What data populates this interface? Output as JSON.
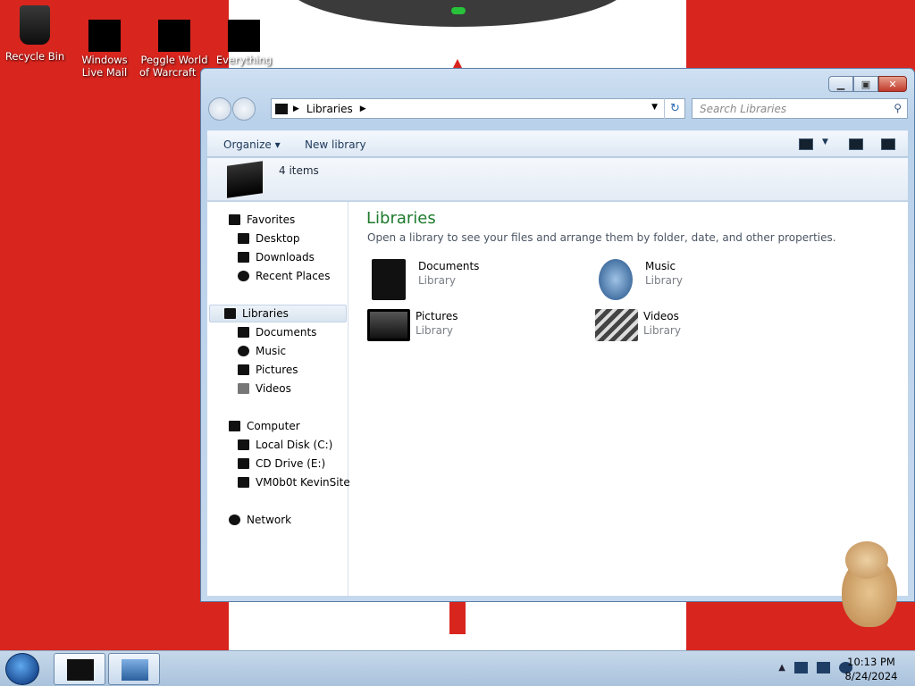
{
  "desktop": {
    "icons": [
      {
        "label": "Recycle Bin"
      },
      {
        "label": "Windows Live Mail"
      },
      {
        "label": "Peggle World of Warcraft ..."
      },
      {
        "label": "Everything"
      }
    ]
  },
  "window": {
    "address": {
      "path": "Libraries"
    },
    "search": {
      "placeholder": "Search Libraries"
    },
    "toolbar": {
      "organize": "Organize",
      "new_library": "New library"
    },
    "info": {
      "count": "4 items"
    },
    "nav": {
      "favorites": {
        "label": "Favorites",
        "items": [
          "Desktop",
          "Downloads",
          "Recent Places"
        ]
      },
      "libraries": {
        "label": "Libraries",
        "items": [
          "Documents",
          "Music",
          "Pictures",
          "Videos"
        ]
      },
      "computer": {
        "label": "Computer",
        "items": [
          "Local Disk (C:)",
          "CD Drive (E:)",
          "VM0b0t KevinSite"
        ]
      },
      "network": {
        "label": "Network"
      }
    },
    "content": {
      "title": "Libraries",
      "subtitle": "Open a library to see your files and arrange them by folder, date, and other properties.",
      "libraries": [
        {
          "name": "Documents",
          "type": "Library",
          "icon": "documents-library-icon"
        },
        {
          "name": "Music",
          "type": "Library",
          "icon": "music-library-icon"
        },
        {
          "name": "Pictures",
          "type": "Library",
          "icon": "pictures-library-icon"
        },
        {
          "name": "Videos",
          "type": "Library",
          "icon": "videos-library-icon"
        }
      ]
    }
  },
  "taskbar": {
    "time": "10:13 PM",
    "date": "8/24/2024"
  },
  "colors": {
    "accent_title": "#1e7a2c",
    "wallpaper_red": "#d8251e"
  }
}
